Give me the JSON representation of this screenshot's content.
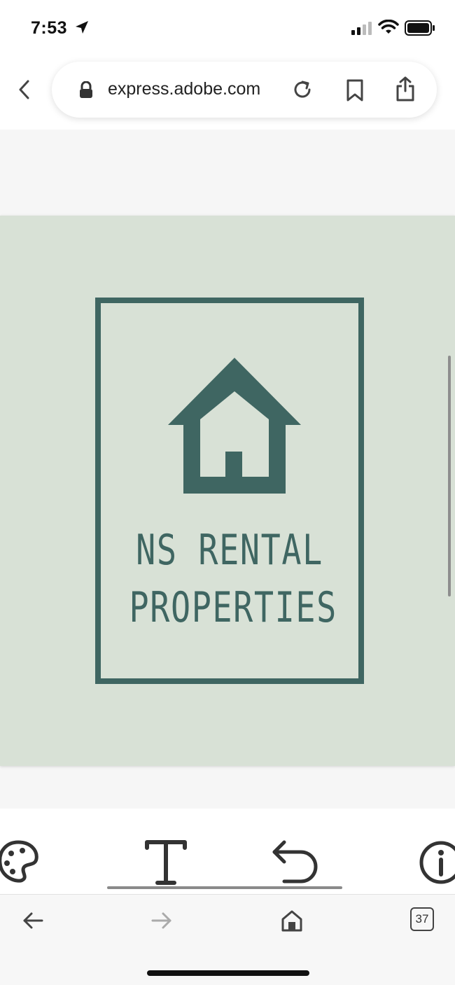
{
  "status_bar": {
    "time": "7:53",
    "icons": [
      "location-arrow-icon",
      "cellular-signal-icon",
      "wifi-icon",
      "battery-icon"
    ]
  },
  "browser": {
    "url": "express.adobe.com",
    "icons": [
      "back-chevron-icon",
      "lock-icon",
      "reload-icon",
      "bookmark-icon",
      "share-icon"
    ]
  },
  "design": {
    "line1": "NS RENTAL",
    "line2": "PROPERTIES",
    "colors": {
      "background": "#d8e1d6",
      "accent": "#3f6662"
    }
  },
  "editor_toolbar": {
    "tools": [
      "color-palette-icon",
      "text-icon",
      "undo-icon",
      "info-icon"
    ]
  },
  "browser_bottom": {
    "tab_count": "37",
    "icons": [
      "back-arrow-icon",
      "forward-arrow-icon",
      "home-icon",
      "tabs-icon"
    ]
  }
}
